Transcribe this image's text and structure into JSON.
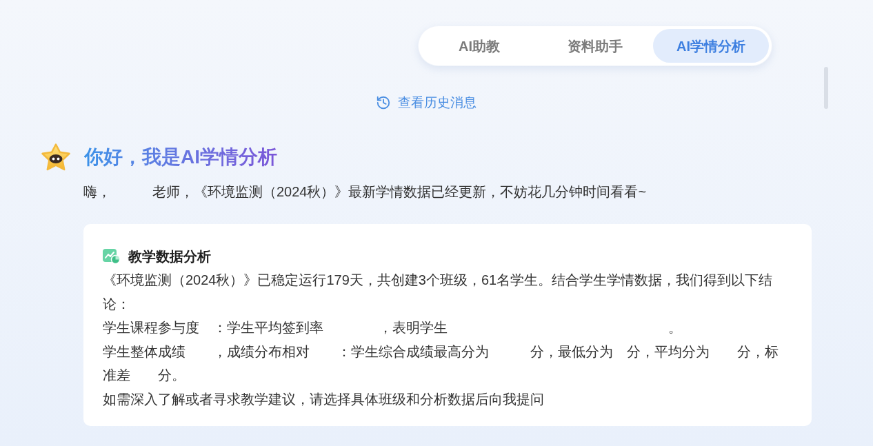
{
  "tabs": [
    {
      "label": "AI助教",
      "selected": false
    },
    {
      "label": "资料助手",
      "selected": false
    },
    {
      "label": "AI学情分析",
      "selected": true
    }
  ],
  "history_link": {
    "label": "查看历史消息"
  },
  "greeting": {
    "title": "你好，我是AI学情分析",
    "message": "嗨，　　　老师，《环境监测（2024秋）》最新学情数据已经更新，不妨花几分钟时间看看~"
  },
  "analysis_card": {
    "title": "教学数据分析",
    "paragraphs": [
      "《环境监测（2024秋）》已稳定运行179天，共创建3个班级，61名学生。结合学生学情数据，我们得到以下结论：",
      "学生课程参与度　：学生平均签到率　　　　，表明学生　　　　　　　　　　　　　　　　。",
      "学生整体成绩　　，成绩分布相对　　：学生综合成绩最高分为　　　分，最低分为　分，平均分为　　分，标准差　　分。",
      "如需深入了解或者寻求教学建议，请选择具体班级和分析数据后向我提问"
    ]
  }
}
